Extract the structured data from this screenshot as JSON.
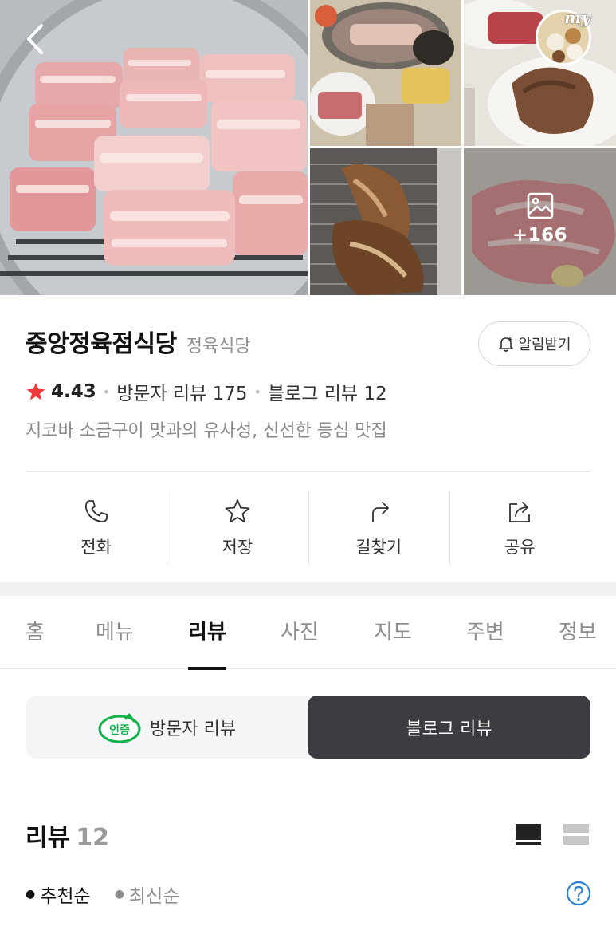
{
  "gallery": {
    "more_count": "+166",
    "badge_label": "my"
  },
  "place": {
    "name": "중앙정육점식당",
    "category": "정육식당",
    "alarm_label": "알림받기",
    "rating": "4.43",
    "visitor_reviews": "방문자 리뷰 175",
    "blog_reviews": "블로그 리뷰 12",
    "description": "지코바 소금구이 맛과의 유사성, 신선한 등심 맛집"
  },
  "actions": [
    {
      "label": "전화",
      "icon": "phone-icon"
    },
    {
      "label": "저장",
      "icon": "star-outline-icon"
    },
    {
      "label": "길찾기",
      "icon": "directions-icon"
    },
    {
      "label": "공유",
      "icon": "share-icon"
    }
  ],
  "tabs": [
    {
      "label": "홈"
    },
    {
      "label": "메뉴"
    },
    {
      "label": "리뷰",
      "active": true
    },
    {
      "label": "사진"
    },
    {
      "label": "지도"
    },
    {
      "label": "주변"
    },
    {
      "label": "정보"
    }
  ],
  "review_toggle": {
    "badge_text": "인증",
    "visitor_label": "방문자 리뷰",
    "blog_label": "블로그 리뷰",
    "selected": "blog"
  },
  "reviews": {
    "title": "리뷰",
    "count": "12",
    "sort_options": [
      {
        "label": "추천순",
        "active": true
      },
      {
        "label": "최신순",
        "active": false
      }
    ]
  },
  "colors": {
    "star": "#f0383d",
    "badge_green": "#14b14a",
    "toggle_dark": "#3b3b41",
    "help_blue": "#2a83d6"
  }
}
